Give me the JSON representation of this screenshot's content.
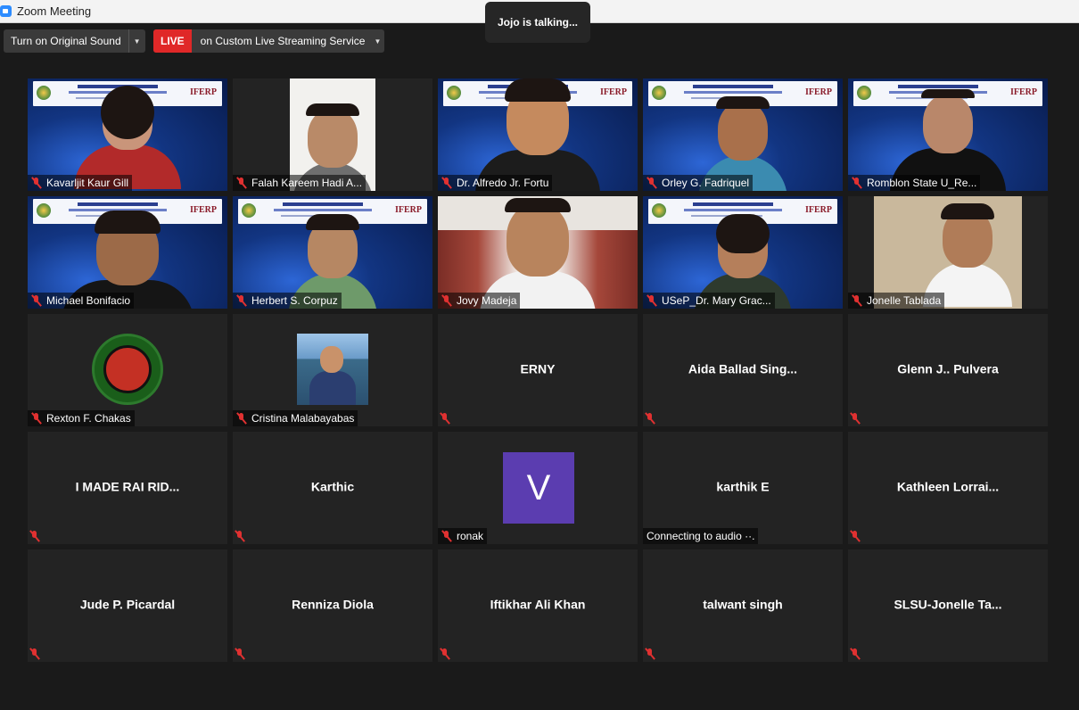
{
  "window": {
    "title": "Zoom Meeting"
  },
  "toolbar": {
    "original_sound_label": "Turn on Original Sound",
    "live_badge": "LIVE",
    "live_label": "on Custom Live Streaming Service"
  },
  "talking_indicator": "Jojo is talking...",
  "participants": [
    {
      "name": "Kavarljit Kaur Gill",
      "type": "video"
    },
    {
      "name": "Falah Kareem Hadi A...",
      "type": "video"
    },
    {
      "name": "Dr. Alfredo Jr. Fortu",
      "type": "video"
    },
    {
      "name": "Orley G. Fadriquel",
      "type": "video"
    },
    {
      "name": "Romblon State U_Re...",
      "type": "video"
    },
    {
      "name": "Michael Bonifacio",
      "type": "video"
    },
    {
      "name": "Herbert S. Corpuz",
      "type": "video"
    },
    {
      "name": "Jovy Madeja",
      "type": "video"
    },
    {
      "name": "USeP_Dr. Mary Grac...",
      "type": "video"
    },
    {
      "name": "Jonelle Tablada",
      "type": "video"
    },
    {
      "name": "Rexton F. Chakas",
      "type": "picture"
    },
    {
      "name": "Cristina Malabayabas",
      "type": "picture"
    },
    {
      "name": "ERNY",
      "type": "name"
    },
    {
      "name": "Aida  Ballad  Sing...",
      "type": "name"
    },
    {
      "name": "Glenn J.. Pulvera",
      "type": "name"
    },
    {
      "name": "I MADE RAI RID...",
      "type": "name"
    },
    {
      "name": "Karthic",
      "type": "name"
    },
    {
      "name": "ronak",
      "type": "avatar",
      "avatar_letter": "V"
    },
    {
      "name": "karthik E",
      "type": "name",
      "status": "Connecting to audio ··."
    },
    {
      "name": "Kathleen  Lorrai...",
      "type": "name"
    },
    {
      "name": "Jude P. Picardal",
      "type": "name"
    },
    {
      "name": "Renniza Diola",
      "type": "name"
    },
    {
      "name": "Iftikhar Ali Khan",
      "type": "name"
    },
    {
      "name": "talwant singh",
      "type": "name"
    },
    {
      "name": "SLSU-Jonelle  Ta...",
      "type": "name"
    }
  ]
}
